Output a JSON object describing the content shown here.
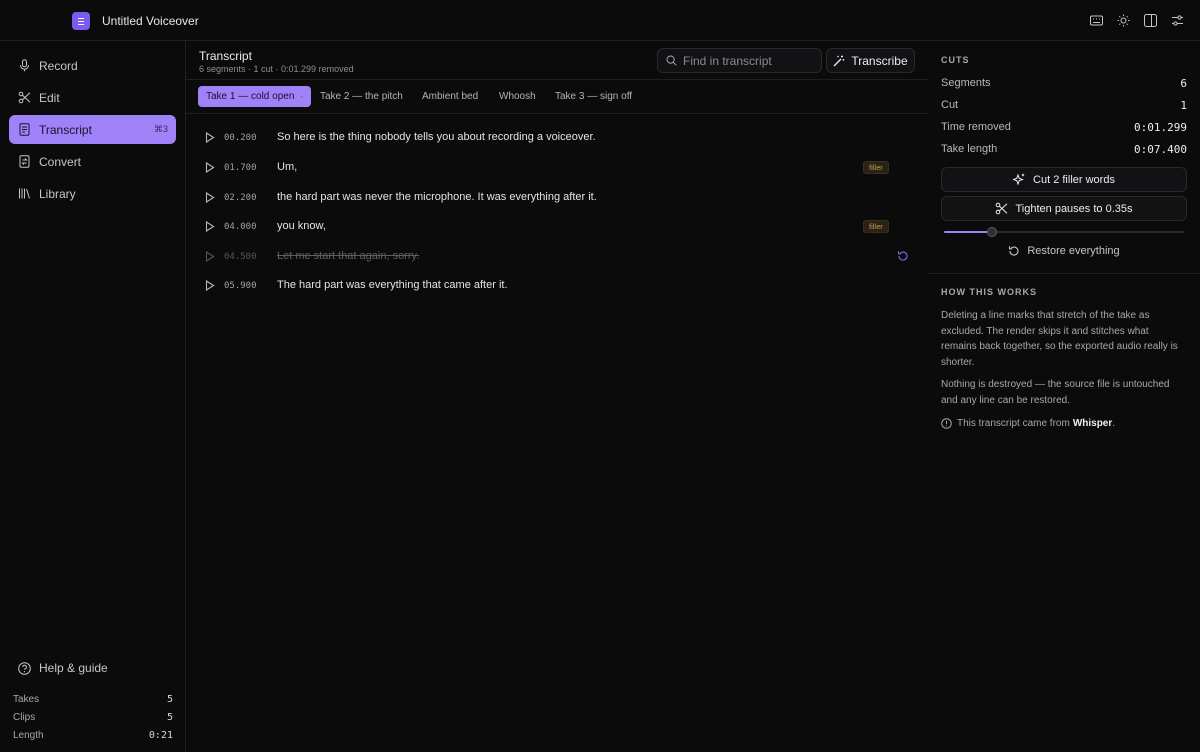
{
  "app": {
    "title": "Untitled Voiceover"
  },
  "top_icons": [
    "keyboard-icon",
    "sun-icon",
    "sidebar-icon",
    "sliders-icon"
  ],
  "sidebar": {
    "items": [
      {
        "label": "Record",
        "icon": "mic-icon"
      },
      {
        "label": "Edit",
        "icon": "scissors-icon"
      },
      {
        "label": "Transcript",
        "icon": "document-icon",
        "active": true,
        "badge": "⌘3"
      },
      {
        "label": "Convert",
        "icon": "convert-icon"
      },
      {
        "label": "Library",
        "icon": "library-icon"
      }
    ],
    "help_label": "Help & guide",
    "stats": [
      {
        "label": "Takes",
        "value": "5"
      },
      {
        "label": "Clips",
        "value": "5"
      },
      {
        "label": "Length",
        "value": "0:21"
      }
    ]
  },
  "main": {
    "title": "Transcript",
    "subtitle": "6 segments · 1 cut · 0:01.299 removed",
    "search": {
      "placeholder": "Find in transcript",
      "value": ""
    },
    "transcribe_label": "Transcribe",
    "tabs": [
      {
        "label": "Take 1 — cold open",
        "active": true,
        "dot": "·"
      },
      {
        "label": "Take 2 — the pitch"
      },
      {
        "label": "Ambient bed"
      },
      {
        "label": "Whoosh"
      },
      {
        "label": "Take 3 — sign off"
      }
    ],
    "segments": [
      {
        "time": "00.200",
        "text": "So here is the thing nobody tells you about recording a voiceover.",
        "cut": false
      },
      {
        "time": "01.700",
        "text": "Um,",
        "cut": false,
        "tag": "filler"
      },
      {
        "time": "02.200",
        "text": "the hard part was never the microphone. It was everything after it.",
        "cut": false
      },
      {
        "time": "04.000",
        "text": "you know,",
        "cut": false,
        "tag": "filler"
      },
      {
        "time": "04.500",
        "text": "Let me start that again, sorry.",
        "cut": true
      },
      {
        "time": "05.900",
        "text": "The hard part was everything that came after it.",
        "cut": false
      }
    ]
  },
  "panel": {
    "cuts_title": "CUTS",
    "stats": [
      {
        "label": "Segments",
        "value": "6"
      },
      {
        "label": "Cut",
        "value": "1"
      },
      {
        "label": "Time removed",
        "value": "0:01.299"
      },
      {
        "label": "Take length",
        "value": "0:07.400"
      }
    ],
    "cut_filler_label": "Cut 2 filler words",
    "tighten_label": "Tighten pauses to 0.35s",
    "pause_slider_fraction": 0.2,
    "restore_label": "Restore everything",
    "how_title": "HOW THIS WORKS",
    "how_p1": "Deleting a line marks that stretch of the take as excluded. The render skips it and stitches what remains back together, so the exported audio really is shorter.",
    "how_p2": "Nothing is destroyed — the source file is untouched and any line can be restored.",
    "source_prefix": "This transcript came from",
    "source_name": "Whisper",
    "source_suffix": "."
  },
  "colors": {
    "accent": "#9f82f7",
    "background": "#0b0b0c",
    "filler_tag": "#c89a55"
  }
}
